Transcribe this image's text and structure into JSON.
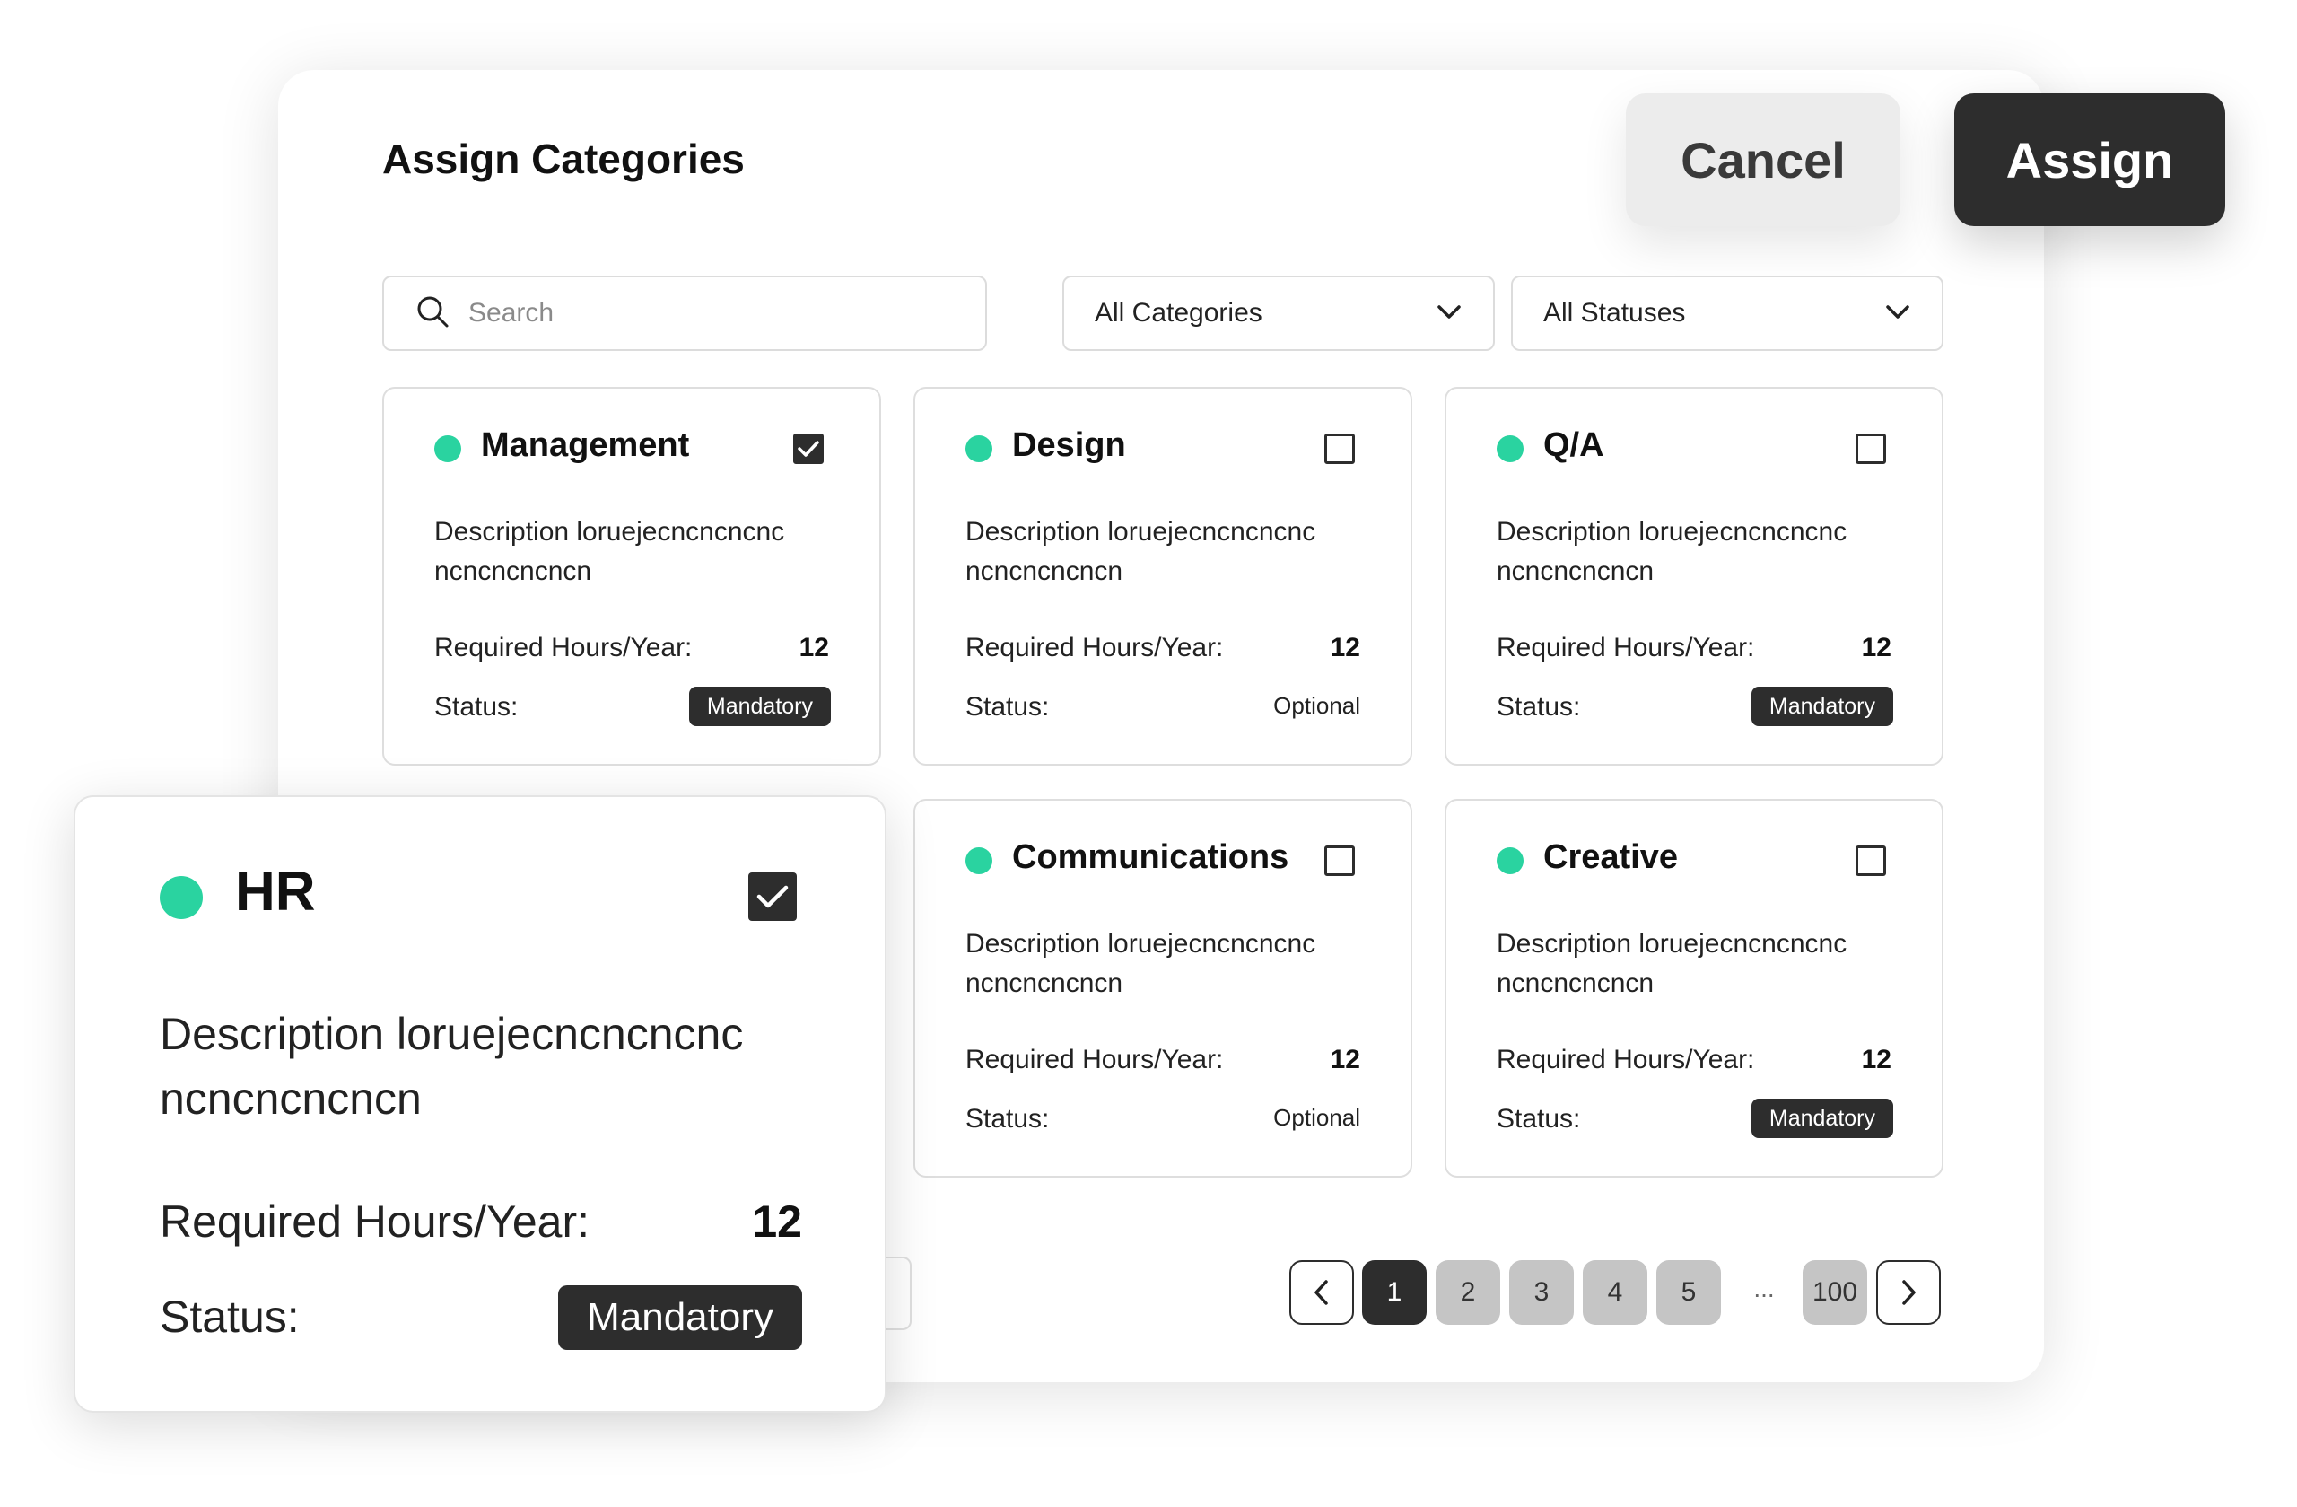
{
  "title": "Assign Categories",
  "actions": {
    "cancel_label": "Cancel",
    "assign_label": "Assign"
  },
  "search": {
    "placeholder": "Search",
    "value": ""
  },
  "filters": {
    "category": "All Categories",
    "status": "All Statuses"
  },
  "colors": {
    "accent": "#2ad3a0",
    "dark": "#2d2d2d",
    "page_button": "#c5c5c5"
  },
  "hours_label": "Required Hours/Year:",
  "status_label": "Status:",
  "cards": [
    {
      "name": "Management",
      "description": "Description loruejecncncncnc ncncncncncn",
      "hours": "12",
      "status": "Mandatory",
      "checked": true
    },
    {
      "name": "Design",
      "description": "Description loruejecncncncnc ncncncncncn",
      "hours": "12",
      "status": "Optional",
      "checked": false
    },
    {
      "name": "Q/A",
      "description": "Description loruejecncncncnc ncncncncncn",
      "hours": "12",
      "status": "Mandatory",
      "checked": false
    },
    {
      "name": "Communications",
      "description": "Description loruejecncncncnc ncncncncncn",
      "hours": "12",
      "status": "Optional",
      "checked": false
    },
    {
      "name": "Creative",
      "description": "Description loruejecncncncnc ncncncncncn",
      "hours": "12",
      "status": "Mandatory",
      "checked": false
    }
  ],
  "hr_card": {
    "name": "HR",
    "description": "Description loruejecncncncnc ncncncncncn",
    "hours": "12",
    "status": "Mandatory",
    "checked": true
  },
  "pagination": {
    "pages": [
      "1",
      "2",
      "3",
      "4",
      "5"
    ],
    "ellipsis": "...",
    "last": "100",
    "current": "1"
  }
}
